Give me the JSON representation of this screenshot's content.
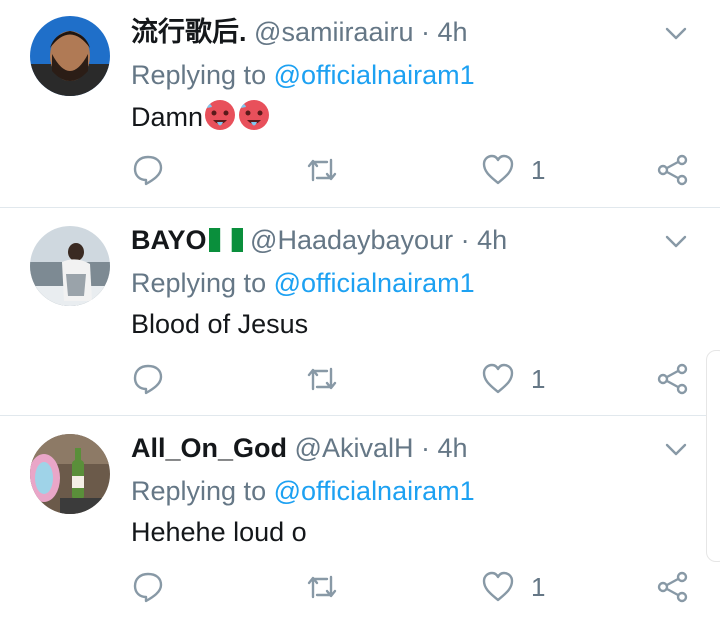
{
  "tweets": [
    {
      "name": "流行歌后.",
      "handle": "@samiiraairu",
      "separator": "·",
      "time": "4h",
      "replying_prefix": "Replying to",
      "replying_to": "@officialnairam1",
      "text": "Damn",
      "text_emoji": [
        "hot-face-emoji",
        "hot-face-emoji"
      ],
      "like_count": "1"
    },
    {
      "name": "BAYO",
      "name_emoji": "nigeria-flag",
      "handle": "@Haadaybayour",
      "separator": "·",
      "time": "4h",
      "replying_prefix": "Replying to",
      "replying_to": "@officialnairam1",
      "text": "Blood of Jesus",
      "like_count": "1"
    },
    {
      "name": "All_On_God",
      "handle": "@AkivalH",
      "separator": "·",
      "time": "4h",
      "replying_prefix": "Replying to",
      "replying_to": "@officialnairam1",
      "text": "Hehehe loud o",
      "like_count": "1"
    }
  ],
  "colors": {
    "link": "#1da1f2",
    "muted": "#657786",
    "text": "#14171a",
    "divider": "#e1e8ed"
  },
  "icons": [
    "chevron-down-icon",
    "reply-icon",
    "retweet-icon",
    "like-icon",
    "share-icon"
  ]
}
